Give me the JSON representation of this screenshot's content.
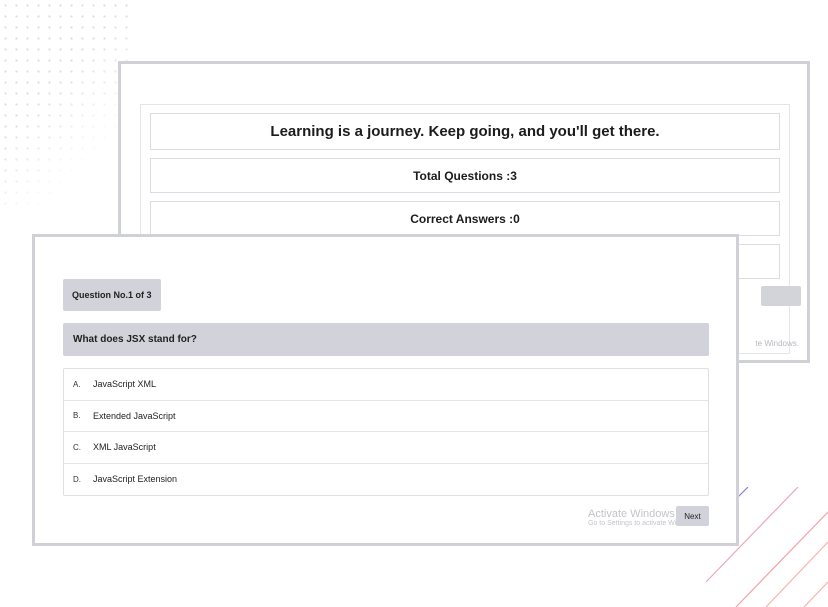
{
  "results": {
    "message": "Learning is a journey. Keep going, and you'll get there.",
    "total_questions": "Total Questions :3",
    "correct_answers": "Correct Answers :0",
    "watermark_partial": "te Windows."
  },
  "quiz": {
    "question_number": "Question No.1 of 3",
    "question_text": "What does JSX stand for?",
    "options": [
      {
        "letter": "A.",
        "text": "JavaScript XML"
      },
      {
        "letter": "B.",
        "text": "Extended JavaScript"
      },
      {
        "letter": "C.",
        "text": "XML JavaScript"
      },
      {
        "letter": "D.",
        "text": "JavaScript Extension"
      }
    ],
    "next_label": "Next"
  },
  "watermark": {
    "title": "Activate Windows",
    "subtitle": "Go to Settings to activate Windows."
  },
  "colors": {
    "panel_gray": "#d2d3da",
    "border_gray": "#d0d1d6",
    "line_purple": "#8a7fd6",
    "line_pink": "#f3a3a8"
  }
}
